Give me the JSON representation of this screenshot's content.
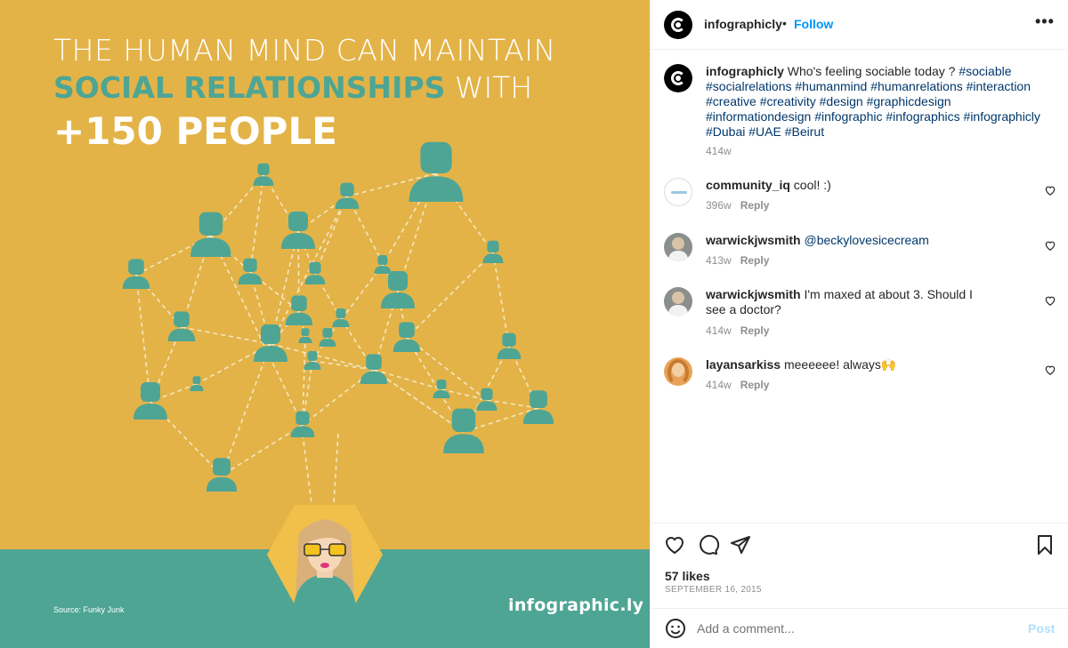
{
  "infographic": {
    "headline_line1": "THE HUMAN MIND CAN MAINTAIN",
    "headline_accent": "SOCIAL RELATIONSHIPS",
    "headline_plain": " WITH",
    "headline_line3": "+150 PEOPLE",
    "source": "Source: Funky Junk",
    "brand": "infographic.ly",
    "colors": {
      "background": "#e3b348",
      "teal": "#4ea594",
      "text": "#ffffff"
    }
  },
  "post": {
    "username": "infographicly",
    "separator": "•",
    "follow_label": "Follow",
    "more_icon": "more-horizontal-icon",
    "caption": {
      "username": "infographicly",
      "text": "Who's feeling sociable today ?",
      "hashtags": [
        "#sociable",
        "#socialrelations",
        "#humanmind",
        "#humanrelations",
        "#interaction",
        "#creative",
        "#creativity",
        "#design",
        "#graphicdesign",
        "#informationdesign",
        "#infographic",
        "#infographics",
        "#infographicly",
        "#Dubai",
        "#UAE",
        "#Beirut"
      ],
      "age": "414w"
    },
    "comments": [
      {
        "username": "community_iq",
        "text": "cool! :)",
        "mention": "",
        "age": "396w",
        "reply_label": "Reply"
      },
      {
        "username": "warwickjwsmith",
        "text": "",
        "mention": "@beckylovesicecream",
        "age": "413w",
        "reply_label": "Reply"
      },
      {
        "username": "warwickjwsmith",
        "text": "I'm maxed at about 3. Should I see a doctor?",
        "mention": "",
        "age": "414w",
        "reply_label": "Reply"
      },
      {
        "username": "layansarkiss",
        "text": "meeeeee! always🙌",
        "mention": "",
        "age": "414w",
        "reply_label": "Reply"
      }
    ],
    "likes": "57 likes",
    "date": "SEPTEMBER 16, 2015",
    "comment_placeholder": "Add a comment...",
    "post_label": "Post",
    "colors": {
      "link": "#0095f6",
      "hashtag": "#00376b",
      "muted": "#8e8e8e",
      "post_disabled": "#b2dffc"
    }
  }
}
